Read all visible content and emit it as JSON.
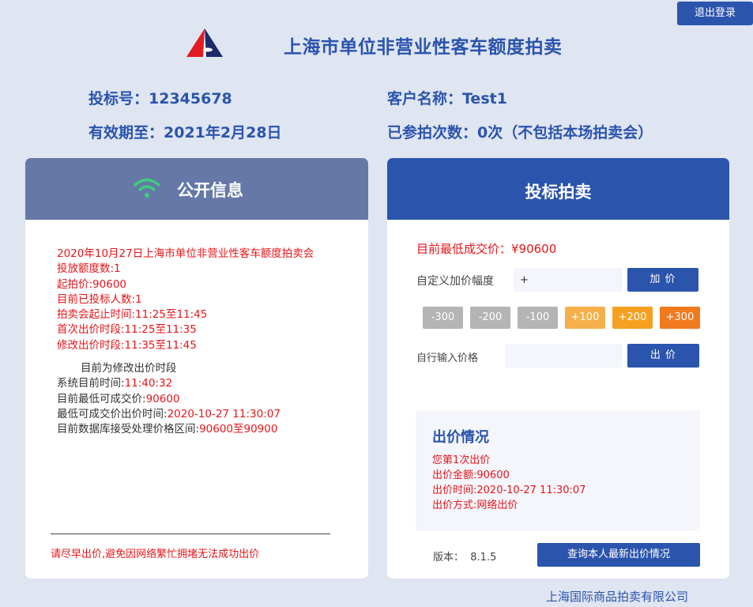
{
  "header": {
    "logout_label": "退出登录",
    "title": "上海市单位非营业性客车额度拍卖"
  },
  "user_info": {
    "bid_no": "投标号：12345678",
    "customer_name": "客户名称：Test1",
    "valid_until": "有效期至：2021年2月28日",
    "participation_count": "已参拍次数：0次（不包括本场拍卖会）"
  },
  "public_panel": {
    "title": "公开信息",
    "icon": "wifi-icon",
    "auction_name": "2020年10月27日上海市单位非营业性客车额度拍卖会",
    "quota": "投放额度数:1",
    "start_price": "起拍价:90600",
    "bidders": "目前已投标人数:1",
    "auction_time": "拍卖会起止时间:11:25至11:45",
    "first_bid_period": "首次出价时段:11:25至11:35",
    "modify_bid_period": "修改出价时段:11:35至11:45",
    "current_phase": "目前为修改出价时段",
    "system_time_label": "系统目前时间:",
    "system_time_value": "11:40:32",
    "lowest_price_label": "目前最低可成交价:",
    "lowest_price_value": "90600",
    "lowest_price_time_label": "最低可成交价出价时间:",
    "lowest_price_time_value": "2020-10-27 11:30:07",
    "price_range_label": "目前数据库接受处理价格区间:",
    "price_range_value": "90600至90900",
    "notice": "请尽早出价,避免因网络繁忙拥堵无法成功出价"
  },
  "bid_panel": {
    "title": "投标拍卖",
    "lowest_deal_price": "目前最低成交价：¥90600",
    "custom_increase_label": "自定义加价幅度",
    "custom_increase_value": "+",
    "add_price_button": "加 价",
    "increments": [
      "-300",
      "-200",
      "-100",
      "+100",
      "+200",
      "+300"
    ],
    "manual_price_label": "自行输入价格",
    "manual_price_value": "",
    "submit_button": "出 价",
    "bid_status_title": "出价情况",
    "bid_count": "您第1次出价",
    "bid_amount": "出价金额:90600",
    "bid_time": "出价时间:2020-10-27 11:30:07",
    "bid_method": "出价方式:网络出价",
    "version": "版本：  8.1.5",
    "query_button": "查询本人最新出价情况"
  },
  "footer": {
    "company": "上海国际商品拍卖有限公司"
  },
  "colors": {
    "primary": "#2b54ad",
    "panel_head_gray": "#6578a8",
    "alert_red": "#e8151a",
    "wifi_green": "#3ccf7a",
    "increment_gray": "#b4b4b4",
    "increment_orange": "#f6a021"
  }
}
